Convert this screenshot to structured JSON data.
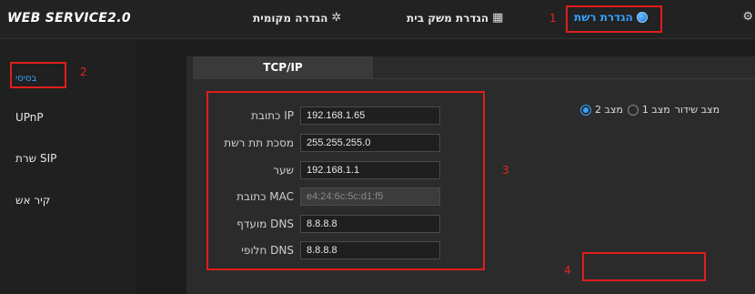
{
  "app": {
    "logo": "WEB SERVICE2.0"
  },
  "nav": {
    "local": {
      "label": "הגדרה מקומית",
      "icon": "gear-icon"
    },
    "household": {
      "label": "הגדרת משק בית",
      "icon": "building-icon"
    },
    "network": {
      "label": "הגדרת רשת",
      "icon": "globe-icon"
    }
  },
  "annotations": {
    "n1": "1",
    "n2": "2",
    "n3": "3",
    "n4": "4"
  },
  "sidebar": {
    "items": [
      {
        "label": "בסיסי"
      },
      {
        "label": "UPnP"
      },
      {
        "label": "שרת SIP"
      },
      {
        "label": "קיר אש"
      }
    ]
  },
  "tabs": [
    {
      "label": "TCP/IP"
    }
  ],
  "form": {
    "ip_label": "IP כתובת",
    "ip_value": "192.168.1.65",
    "mask_label": "מסכת תת רשת",
    "mask_value": "255.255.255.0",
    "gateway_label": "שער",
    "gateway_value": "192.168.1.1",
    "mac_label": "MAC כתובת",
    "mac_value": "e4:24:6c:5c:d1:f5",
    "dns1_label": "DNS מועדף",
    "dns1_value": "8.8.8.8",
    "dns2_label": "DNS חלופי",
    "dns2_value": "8.8.8.8"
  },
  "mode": {
    "label": "מצב שידור",
    "option1": "מצב 1",
    "option2": "מצב 2",
    "selected": "option2"
  },
  "colors": {
    "accent": "#35a2ff",
    "annotation": "#e01d1d"
  }
}
